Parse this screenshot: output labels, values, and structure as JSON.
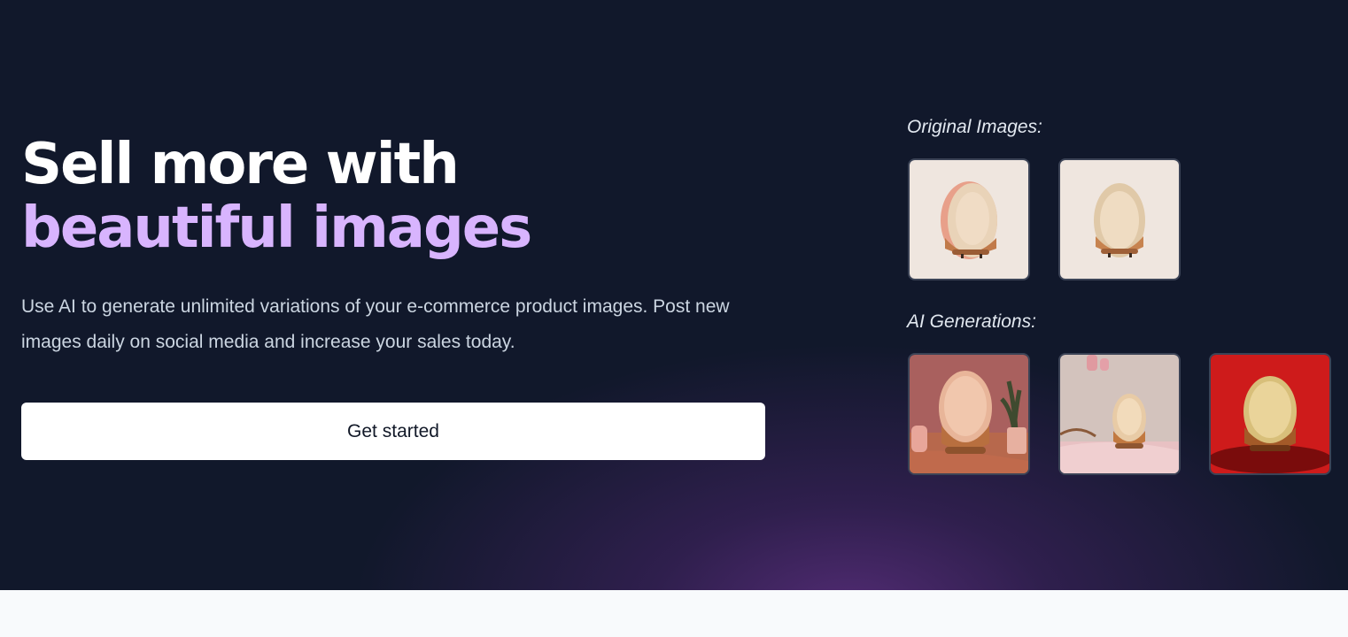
{
  "hero": {
    "headline_line1": "Sell more with",
    "headline_line2": "beautiful images",
    "description": "Use AI to generate unlimited variations of your e-commerce product images. Post new images daily on social media and increase your sales today.",
    "cta_label": "Get started"
  },
  "gallery": {
    "original_label": "Original Images:",
    "ai_label": "AI Generations:"
  },
  "colors": {
    "background": "#11182b",
    "accent": "#d8b4fe",
    "cta_background": "#ffffff"
  }
}
